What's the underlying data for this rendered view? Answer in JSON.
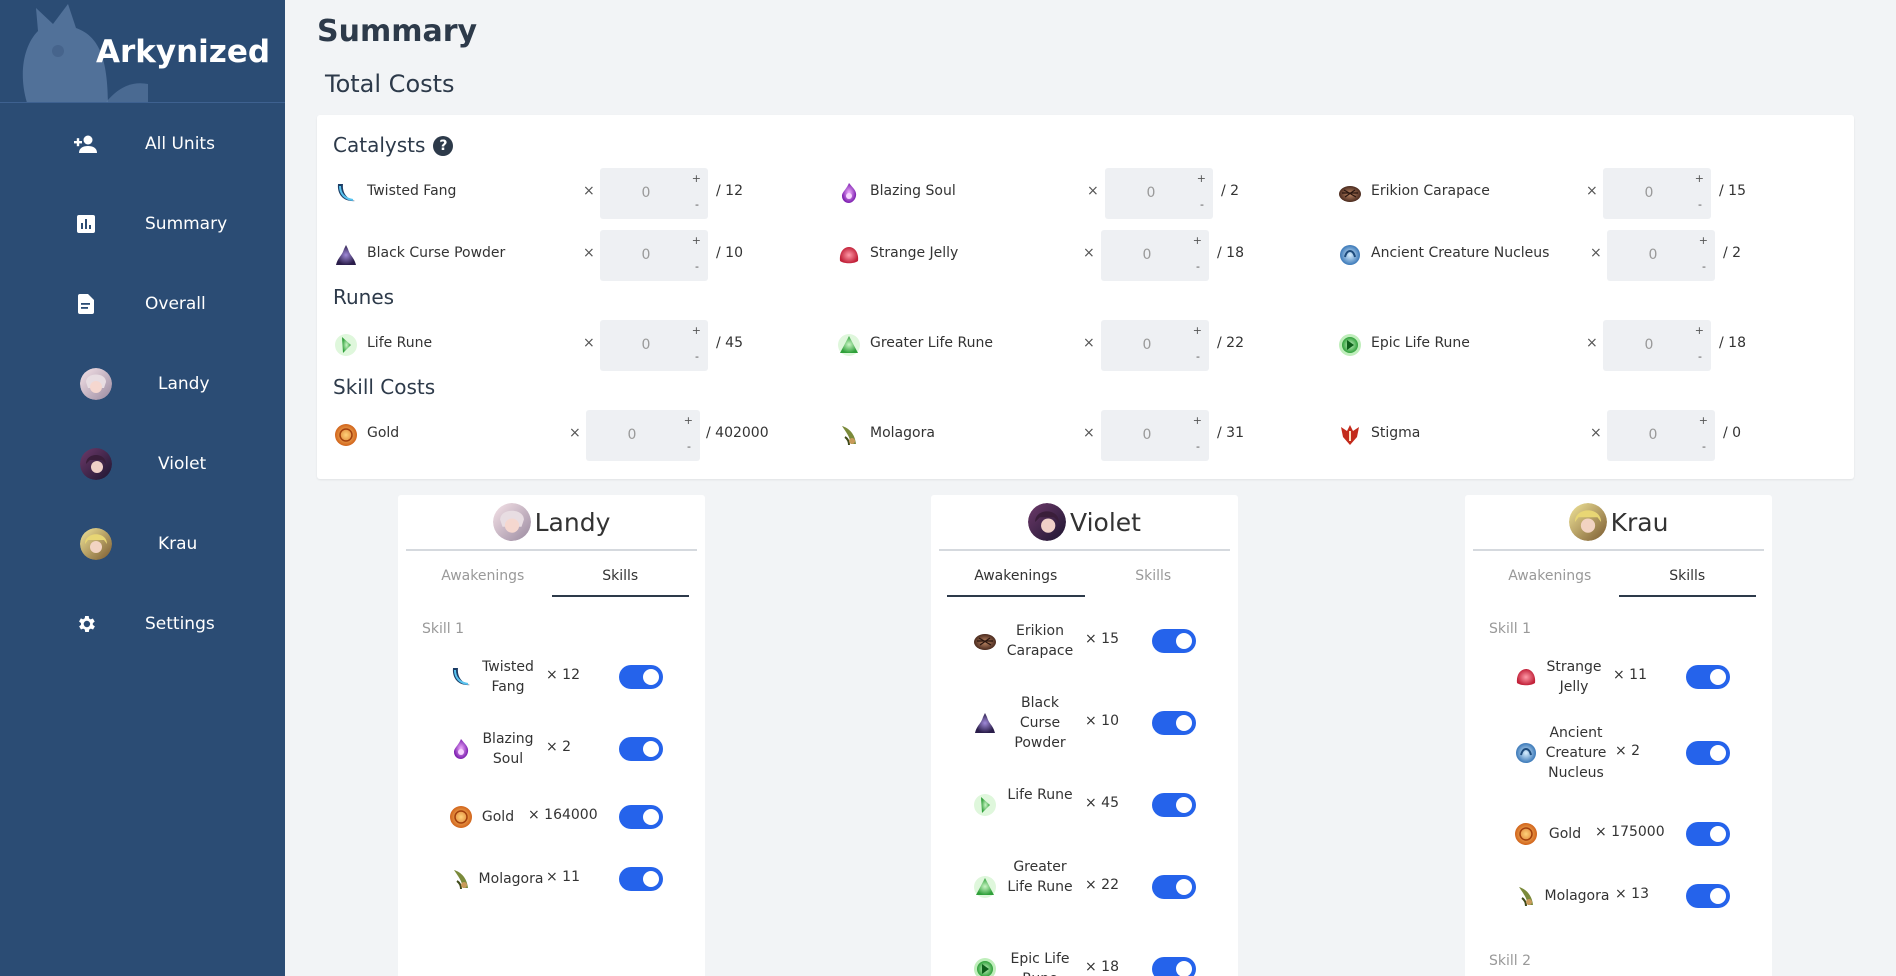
{
  "app": {
    "brand": "Arkynized"
  },
  "sidebar": {
    "items": [
      {
        "label": "All Units",
        "icon": "add-user-icon"
      },
      {
        "label": "Summary",
        "icon": "chart-icon"
      },
      {
        "label": "Overall",
        "icon": "document-icon"
      },
      {
        "label": "Landy",
        "icon": "avatar"
      },
      {
        "label": "Violet",
        "icon": "avatar"
      },
      {
        "label": "Krau",
        "icon": "avatar"
      },
      {
        "label": "Settings",
        "icon": "gear-icon"
      }
    ]
  },
  "page": {
    "title": "Summary",
    "subtitle": "Total Costs"
  },
  "costs": {
    "catalysts_title": "Catalysts",
    "help": "?",
    "runes_title": "Runes",
    "skill_costs_title": "Skill Costs",
    "times": "×",
    "plus": "+",
    "minus": "-",
    "catalysts": [
      {
        "name": "Twisted Fang",
        "value": "0",
        "total": "/  12"
      },
      {
        "name": "Blazing Soul",
        "value": "0",
        "total": "/  2"
      },
      {
        "name": "Erikion Carapace",
        "value": "0",
        "total": "/  15"
      },
      {
        "name": "Black Curse Powder",
        "value": "0",
        "total": "/  10"
      },
      {
        "name": "Strange Jelly",
        "value": "0",
        "total": "/  18"
      },
      {
        "name": "Ancient Creature Nucleus",
        "value": "0",
        "total": "/  2"
      }
    ],
    "runes": [
      {
        "name": "Life Rune",
        "value": "0",
        "total": "/  45"
      },
      {
        "name": "Greater Life Rune",
        "value": "0",
        "total": "/  22"
      },
      {
        "name": "Epic Life Rune",
        "value": "0",
        "total": "/  18"
      }
    ],
    "skill_costs": [
      {
        "name": "Gold",
        "value": "0",
        "total": "/  402000"
      },
      {
        "name": "Molagora",
        "value": "0",
        "total": "/  31"
      },
      {
        "name": "Stigma",
        "value": "0",
        "total": "/  0"
      }
    ]
  },
  "units": [
    {
      "name": "Landy",
      "tabs": [
        "Awakenings",
        "Skills"
      ],
      "active_tab": 1,
      "sections": [
        {
          "label": "Skill 1"
        }
      ],
      "items": [
        {
          "name": "Twisted Fang",
          "qty": "×  12",
          "on": true
        },
        {
          "name": "Blazing Soul",
          "qty": "×  2",
          "on": true
        },
        {
          "name": "Gold",
          "qty": "×  164000",
          "on": true
        },
        {
          "name": "Molagora",
          "qty": "×  11",
          "on": true
        }
      ]
    },
    {
      "name": "Violet",
      "tabs": [
        "Awakenings",
        "Skills"
      ],
      "active_tab": 0,
      "sections": [],
      "items": [
        {
          "name": "Erikion Carapace",
          "qty": "×  15",
          "on": true
        },
        {
          "name": "Black Curse Powder",
          "qty": "×  10",
          "on": true
        },
        {
          "name": "Life Rune",
          "qty": "×  45",
          "on": true
        },
        {
          "name": "Greater Life Rune",
          "qty": "×  22",
          "on": true
        },
        {
          "name": "Epic Life Rune",
          "qty": "×  18",
          "on": true
        }
      ]
    },
    {
      "name": "Krau",
      "tabs": [
        "Awakenings",
        "Skills"
      ],
      "active_tab": 1,
      "sections": [
        {
          "label": "Skill 1"
        },
        {
          "label": "Skill 2"
        }
      ],
      "items": [
        {
          "name": "Strange Jelly",
          "qty": "×  11",
          "on": true
        },
        {
          "name": "Ancient Creature Nucleus",
          "qty": "×  2",
          "on": true
        },
        {
          "name": "Gold",
          "qty": "×  175000",
          "on": true
        },
        {
          "name": "Molagora",
          "qty": "×  13",
          "on": true
        }
      ]
    }
  ],
  "colors": {
    "sidebar": "#2b4c74",
    "accent": "#2563eb",
    "text_dark": "#2d3a4a"
  }
}
